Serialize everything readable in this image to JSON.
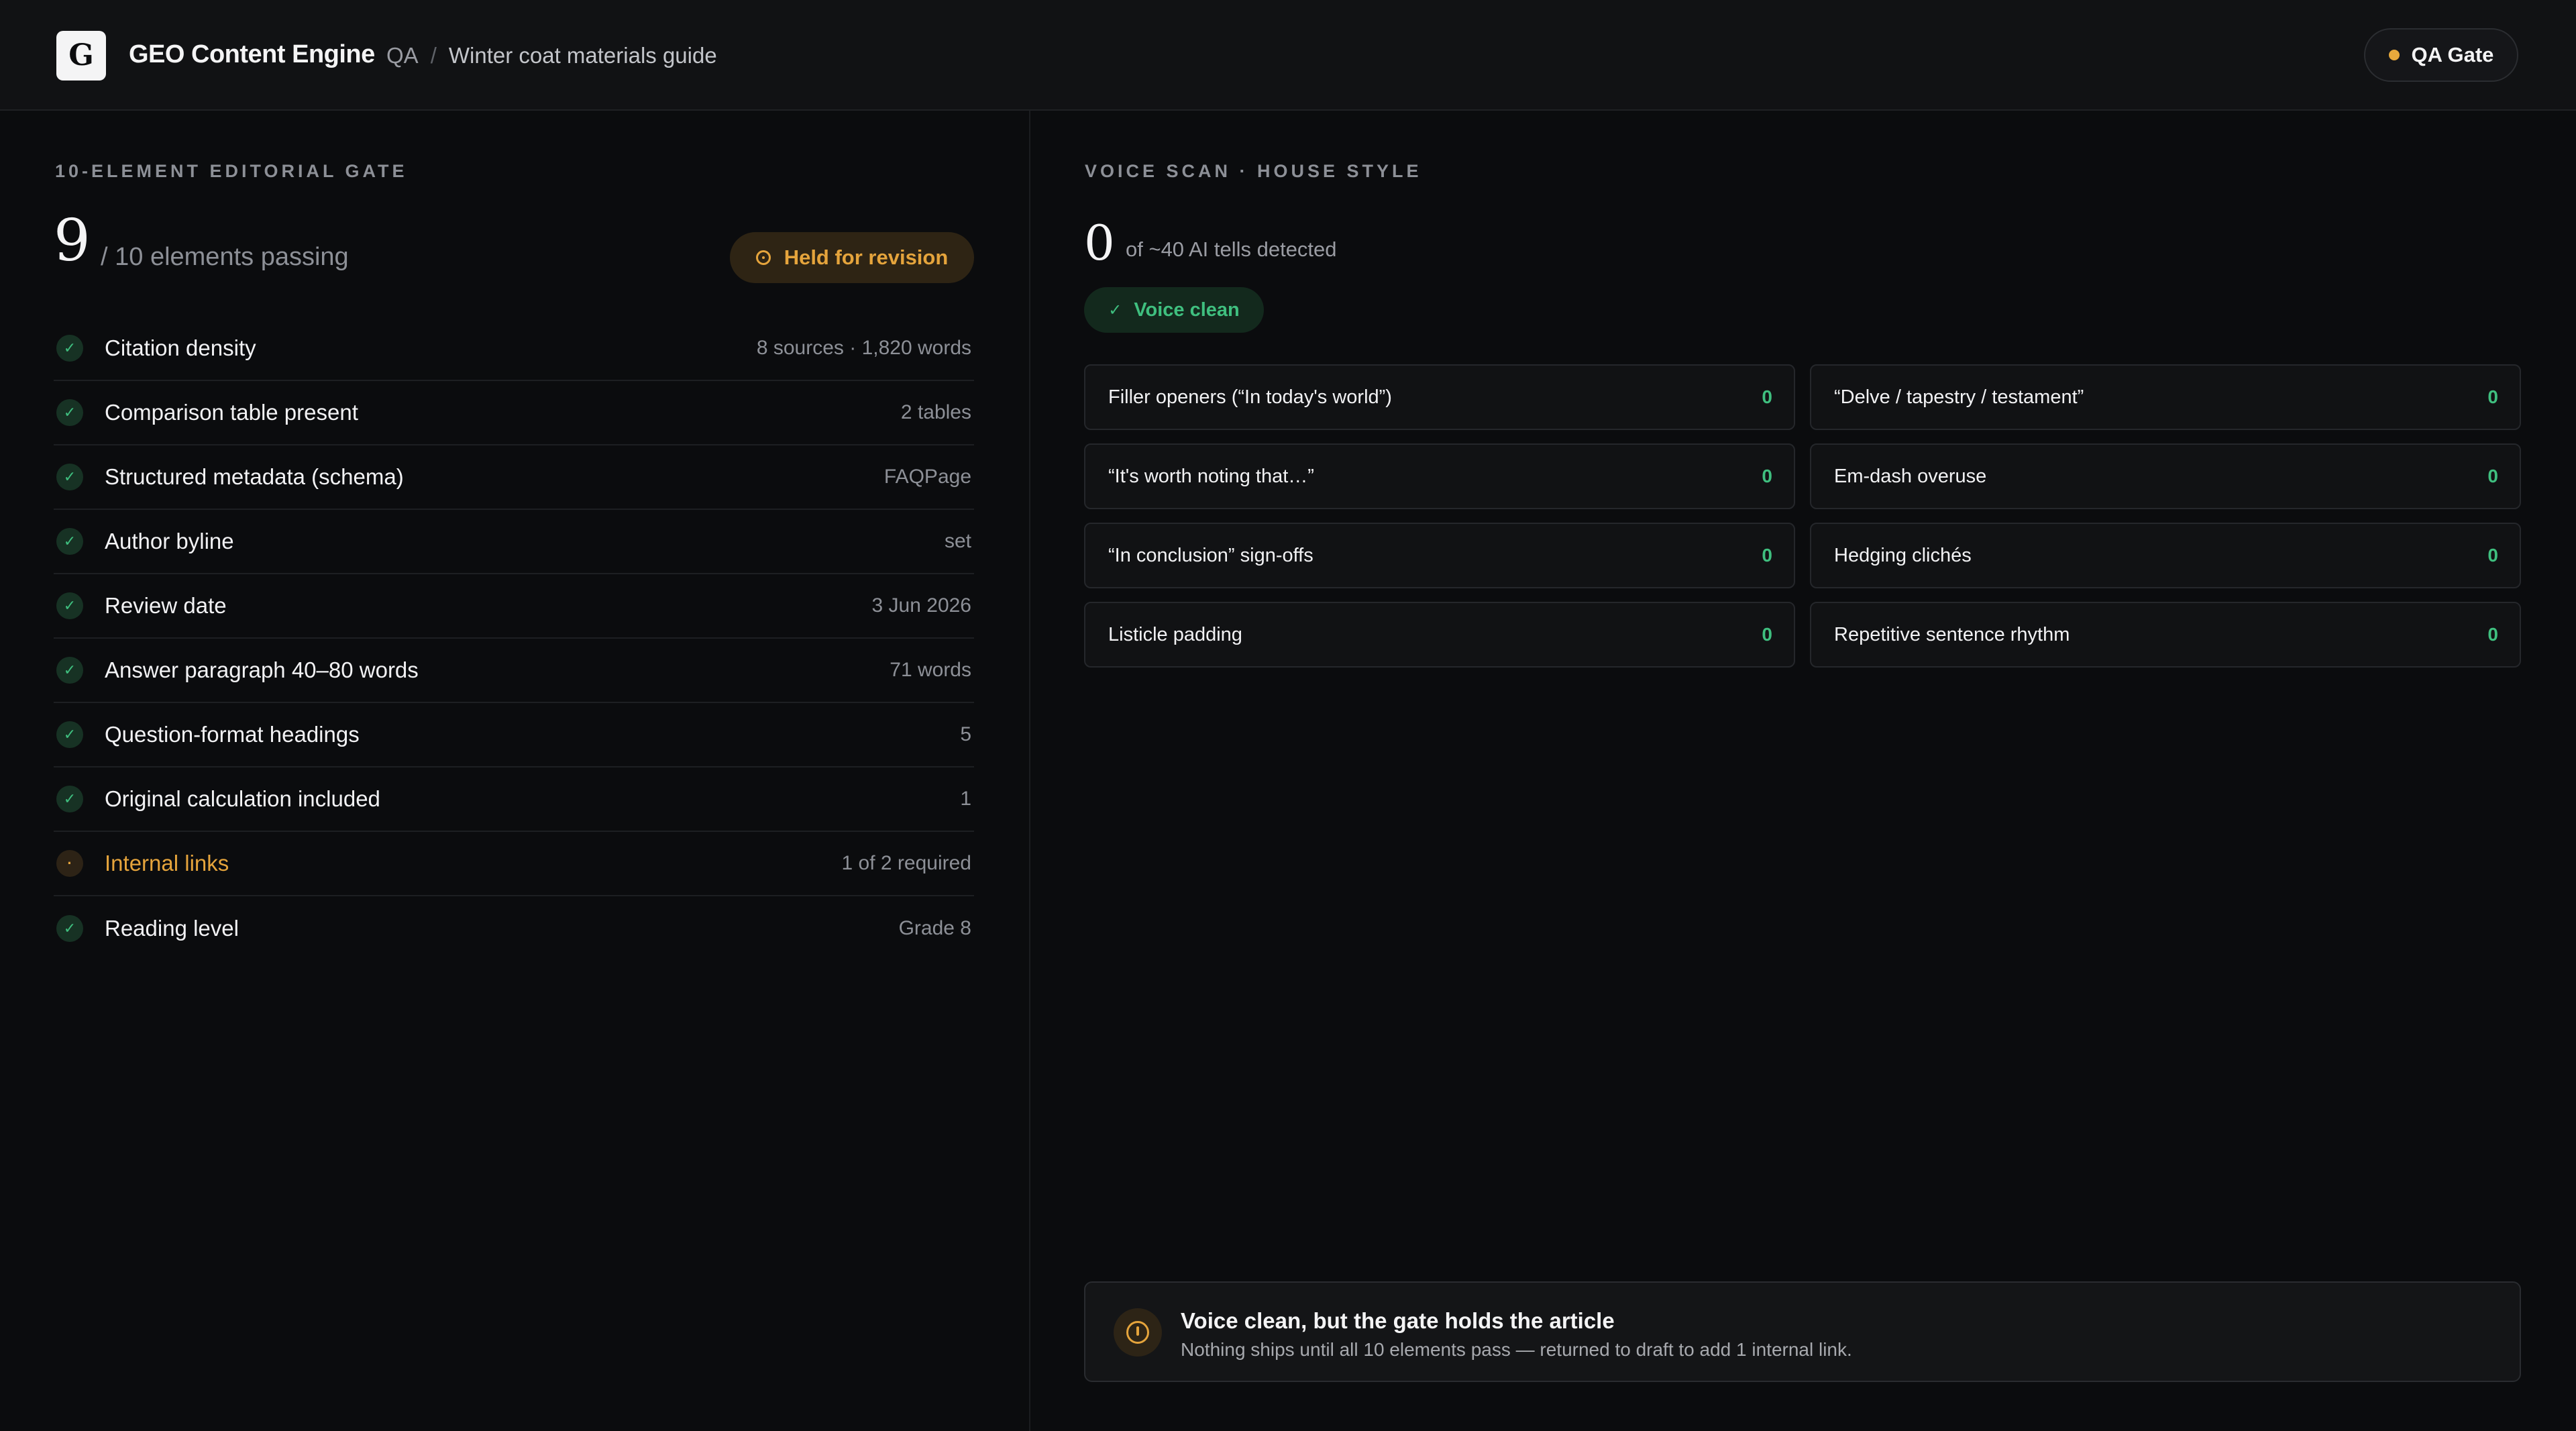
{
  "header": {
    "logo_letter": "G",
    "app_title": "GEO Content Engine",
    "breadcrumb": {
      "section": "QA",
      "separator": "/",
      "current": "Winter coat materials guide"
    },
    "gate_chip": {
      "label": "QA Gate",
      "dot_color": "#e7a93c"
    }
  },
  "left": {
    "eyebrow": "10-ELEMENT EDITORIAL GATE",
    "score": "9",
    "score_sub": "/ 10 elements passing",
    "status_badge": "Held for revision",
    "items": [
      {
        "label": "Citation density",
        "detail": "8 sources · 1,820 words",
        "status": "pass",
        "icon": "✓"
      },
      {
        "label": "Comparison table present",
        "detail": "2 tables",
        "status": "pass",
        "icon": "✓"
      },
      {
        "label": "Structured metadata (schema)",
        "detail": "FAQPage",
        "status": "pass",
        "icon": "✓"
      },
      {
        "label": "Author byline",
        "detail": "set",
        "status": "pass",
        "icon": "✓"
      },
      {
        "label": "Review date",
        "detail": "3 Jun 2026",
        "status": "pass",
        "icon": "✓"
      },
      {
        "label": "Answer paragraph 40–80 words",
        "detail": "71 words",
        "status": "pass",
        "icon": "✓"
      },
      {
        "label": "Question-format headings",
        "detail": "5",
        "status": "pass",
        "icon": "✓"
      },
      {
        "label": "Original calculation included",
        "detail": "1",
        "status": "pass",
        "icon": "✓"
      },
      {
        "label": "Internal links",
        "detail": "1 of 2 required",
        "status": "warn",
        "icon": "·"
      },
      {
        "label": "Reading level",
        "detail": "Grade 8",
        "status": "pass",
        "icon": "✓"
      }
    ]
  },
  "right": {
    "eyebrow": "VOICE SCAN · HOUSE STYLE",
    "count": "0",
    "count_sub": "of ~40 AI tells detected",
    "voice_badge": "Voice clean",
    "voice_badge_icon": "✓",
    "tells": [
      {
        "name": "Filler openers (“In today's world”)",
        "value": "0"
      },
      {
        "name": "“Delve / tapestry / testament”",
        "value": "0"
      },
      {
        "name": "“It's worth noting that…”",
        "value": "0"
      },
      {
        "name": "Em-dash overuse",
        "value": "0"
      },
      {
        "name": "“In conclusion” sign-offs",
        "value": "0"
      },
      {
        "name": "Hedging clichés",
        "value": "0"
      },
      {
        "name": "Listicle padding",
        "value": "0"
      },
      {
        "name": "Repetitive sentence rhythm",
        "value": "0"
      }
    ]
  },
  "notice": {
    "title": "Voice clean, but the gate holds the article",
    "body": "Nothing ships until all 10 elements pass — returned to draft to add 1 internal link."
  },
  "colors": {
    "pass": "#3fbf7f",
    "warn": "#e5a43c",
    "background": "#0b0c0e"
  }
}
